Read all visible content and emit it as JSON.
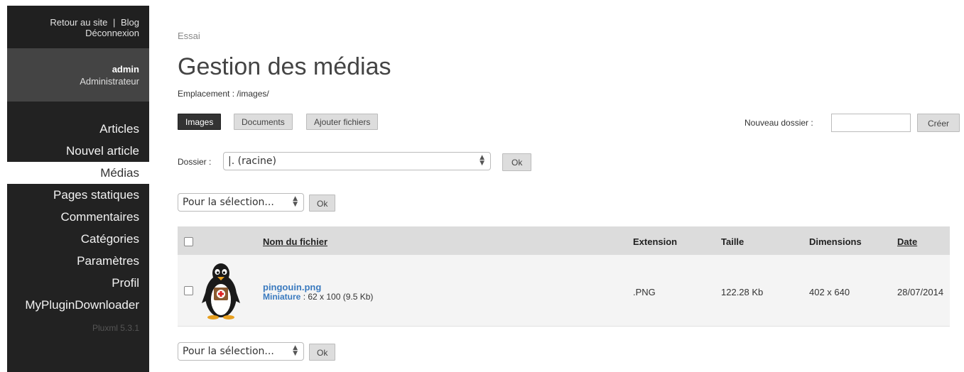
{
  "sidebar": {
    "top_links": {
      "site": "Retour au site",
      "separator": "|",
      "blog": "Blog",
      "logout": "Déconnexion"
    },
    "user": {
      "name": "admin",
      "role": "Administrateur"
    },
    "menu": [
      {
        "label": "Articles"
      },
      {
        "label": "Nouvel article"
      },
      {
        "label": "Médias",
        "active": true
      },
      {
        "label": "Pages statiques"
      },
      {
        "label": "Commentaires"
      },
      {
        "label": "Catégories"
      },
      {
        "label": "Paramètres"
      },
      {
        "label": "Profil"
      },
      {
        "label": "MyPluginDownloader"
      }
    ],
    "version": "Pluxml 5.3.1"
  },
  "main": {
    "breadcrumb": "Essai",
    "title": "Gestion des médias",
    "location": "Emplacement : /images/",
    "tabs": {
      "images": "Images",
      "documents": "Documents",
      "add": "Ajouter fichiers"
    },
    "new_folder": {
      "label": "Nouveau dossier :",
      "value": "",
      "button": "Créer"
    },
    "folder": {
      "label": "Dossier :",
      "selected": "|. (racine)",
      "ok": "Ok"
    },
    "bulk_top": {
      "selected": "Pour la sélection...",
      "ok": "Ok"
    },
    "bulk_bottom": {
      "selected": "Pour la sélection...",
      "ok": "Ok"
    },
    "table": {
      "headers": {
        "name": "Nom du fichier",
        "extension": "Extension",
        "size": "Taille",
        "dimensions": "Dimensions",
        "date": "Date"
      },
      "rows": [
        {
          "filename": "pingouin.png",
          "thumb_label": "Miniature",
          "thumb_info": ": 62 x 100 (9.5 Kb)",
          "extension": ".PNG",
          "size": "122.28 Kb",
          "dimensions": "402 x 640",
          "date": "28/07/2014"
        }
      ]
    }
  },
  "colors": {
    "sidebar_bg": "#222222",
    "accent_link": "#3a7abf",
    "active_btn": "#333333"
  },
  "icons": {
    "thumbnail": "penguin-thumbnail",
    "select_arrows": "updown-arrows-icon"
  }
}
